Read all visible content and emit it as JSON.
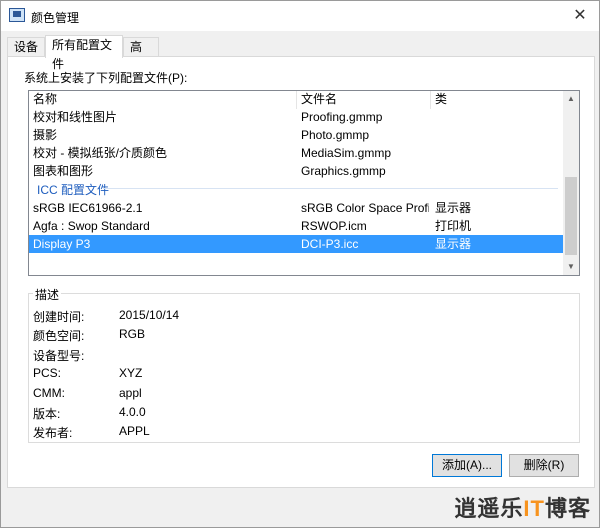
{
  "window": {
    "title": "颜色管理",
    "close_glyph": "✕"
  },
  "tabs": [
    {
      "label": "设备"
    },
    {
      "label": "所有配置文件"
    },
    {
      "label": "高级"
    }
  ],
  "list": {
    "caption": "系统上安装了下列配置文件(P):",
    "headers": [
      "名称",
      "文件名",
      "类"
    ],
    "rows": [
      {
        "name": "校对和线性图片",
        "file": "Proofing.gmmp",
        "class": ""
      },
      {
        "name": "摄影",
        "file": "Photo.gmmp",
        "class": ""
      },
      {
        "name": "校对 - 模拟纸张/介质颜色",
        "file": "MediaSim.gmmp",
        "class": ""
      },
      {
        "name": "图表和图形",
        "file": "Graphics.gmmp",
        "class": ""
      }
    ],
    "group_label": "ICC 配置文件",
    "icc_rows": [
      {
        "name": "sRGB IEC61966-2.1",
        "file": "sRGB Color Space Profil...",
        "class": "显示器"
      },
      {
        "name": "Agfa : Swop Standard",
        "file": "RSWOP.icm",
        "class": "打印机"
      },
      {
        "name": "Display P3",
        "file": "DCI-P3.icc",
        "class": "显示器"
      }
    ],
    "selected_name": "Display P3",
    "scroll_up_glyph": "▲",
    "scroll_down_glyph": "▼"
  },
  "description": {
    "title": "描述",
    "fields": [
      {
        "label": "创建时间:",
        "value": "2015/10/14"
      },
      {
        "label": "颜色空间:",
        "value": "RGB"
      },
      {
        "label": "设备型号:",
        "value": ""
      },
      {
        "label": "PCS:",
        "value": "XYZ"
      },
      {
        "label": "CMM:",
        "value": "appl"
      },
      {
        "label": "版本:",
        "value": "4.0.0"
      },
      {
        "label": "发布者:",
        "value": "APPL"
      }
    ]
  },
  "buttons": {
    "add": "添加(A)...",
    "remove": "删除(R)"
  },
  "watermark": {
    "part1": "逍遥乐",
    "part2": "IT",
    "part3": "博客"
  },
  "colors": {
    "selection": "#3399ff",
    "group_label": "#1e5dbe",
    "default_button_border": "#0078d7"
  }
}
